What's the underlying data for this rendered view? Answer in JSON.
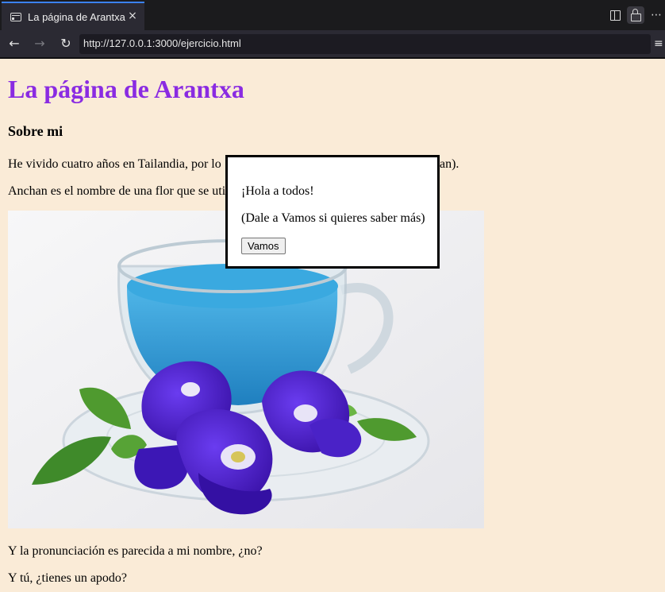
{
  "browser": {
    "tab_title": "La página de Arantxa",
    "tab_icon": "page-icon",
    "close_icon": "×",
    "url": "http://127.0.0.1:3000/ejercicio.html",
    "back_icon": "←",
    "forward_icon": "→",
    "reload_icon": "↻",
    "overflow_icon": "⋯",
    "menu_icon": "≡"
  },
  "page": {
    "title": "La página de Arantxa",
    "subtitle": "Sobre mi",
    "paragraph1": "He vivido cuatro años en Tailandia, por lo",
    "paragraph1_end": "han).",
    "paragraph2": "Anchan es el nombre de una flor que se uti",
    "image_alt": "Taza de té azul de flor de guisante de mariposa con flores",
    "paragraph3": "Y la pronunciación es parecida a mi nombre, ¿no?",
    "paragraph4": "Y tú, ¿tienes un apodo?"
  },
  "dialog": {
    "line1": "¡Hola a todos!",
    "line2": "(Dale a Vamos si quieres saber más)",
    "button_label": "Vamos"
  },
  "colors": {
    "page_background": "#faebd7",
    "title_color": "#8a2be2",
    "tea_blue": "#2f9fd8",
    "flower_purple": "#4b1fc4",
    "leaf_green": "#3f8a2a"
  }
}
